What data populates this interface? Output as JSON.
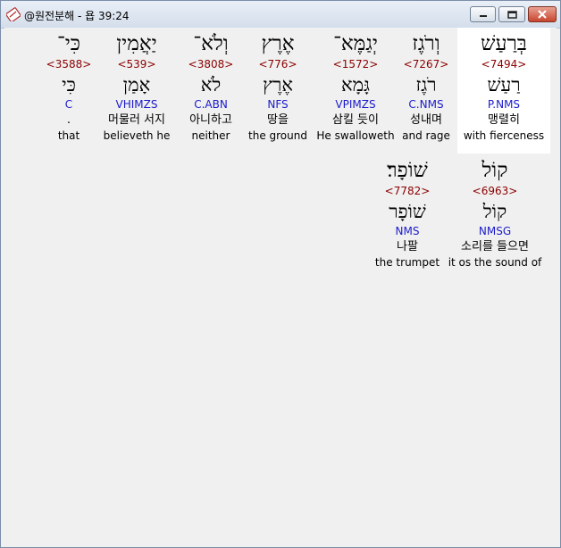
{
  "window": {
    "title": "@원전분해 - 욥 39:24",
    "icon": "bible-app-icon",
    "controls": [
      "minimize-icon",
      "maximize-icon",
      "close-icon"
    ]
  },
  "colors": {
    "strong_number": "#8b0000",
    "morphology": "#1a1acc",
    "selected_background": "#ffffff"
  },
  "row1": [
    {
      "heb": "בְּרַעַשׁ",
      "strong": "<7494>",
      "lemma": "רַעַשׁ",
      "morph": "P.NMS",
      "kor": "맹렬히",
      "eng": "with fierceness"
    },
    {
      "heb": "וְרֹגֶז",
      "strong": "<7267>",
      "lemma": "רֹגֶז",
      "morph": "C.NMS",
      "kor": "성내며",
      "eng": "and rage"
    },
    {
      "heb": "יְגַמֶּא־",
      "strong": "<1572>",
      "lemma": "גָּמָא",
      "morph": "VPIMZS",
      "kor": "삼킬 듯이",
      "eng": "He swalloweth"
    },
    {
      "heb": "אֶרֶץ",
      "strong": "<776>",
      "lemma": "אֶרֶץ",
      "morph": "NFS",
      "kor": "땅을",
      "eng": "the ground"
    },
    {
      "heb": "וְלֹא־",
      "strong": "<3808>",
      "lemma": "לֹא",
      "morph": "C.ABN",
      "kor": "아니하고",
      "eng": "neither"
    },
    {
      "heb": "יַאֲמִין",
      "strong": "<539>",
      "lemma": "אָמַן",
      "morph": "VHIMZS",
      "kor": "머물러 서지",
      "eng": "believeth he"
    },
    {
      "heb": "כִּי־",
      "strong": "<3588>",
      "lemma": "כִּי",
      "morph": "C",
      "kor": ".",
      "eng": "that"
    }
  ],
  "row2": [
    {
      "heb": "קוֹל",
      "strong": "<6963>",
      "lemma": "קוֹל",
      "morph": "NMSG",
      "kor": "소리를 들으면",
      "eng": "it os the sound of"
    },
    {
      "heb": "שׁוֹפָר׃",
      "strong": "<7782>",
      "lemma": "שׁוֹפָר",
      "morph": "NMS",
      "kor": "나팔",
      "eng": "the trumpet"
    }
  ]
}
